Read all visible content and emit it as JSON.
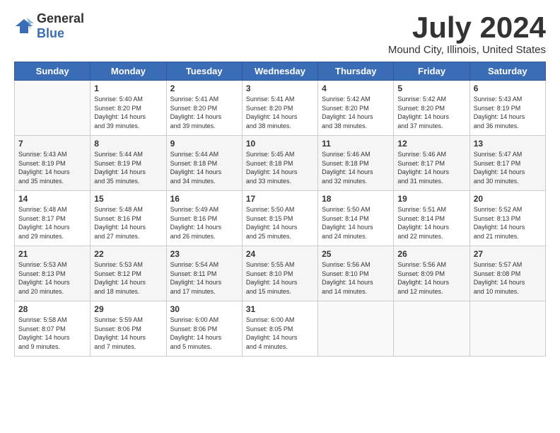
{
  "logo": {
    "general": "General",
    "blue": "Blue"
  },
  "title": "July 2024",
  "location": "Mound City, Illinois, United States",
  "days_of_week": [
    "Sunday",
    "Monday",
    "Tuesday",
    "Wednesday",
    "Thursday",
    "Friday",
    "Saturday"
  ],
  "weeks": [
    [
      {
        "day": "",
        "info": ""
      },
      {
        "day": "1",
        "info": "Sunrise: 5:40 AM\nSunset: 8:20 PM\nDaylight: 14 hours\nand 39 minutes."
      },
      {
        "day": "2",
        "info": "Sunrise: 5:41 AM\nSunset: 8:20 PM\nDaylight: 14 hours\nand 39 minutes."
      },
      {
        "day": "3",
        "info": "Sunrise: 5:41 AM\nSunset: 8:20 PM\nDaylight: 14 hours\nand 38 minutes."
      },
      {
        "day": "4",
        "info": "Sunrise: 5:42 AM\nSunset: 8:20 PM\nDaylight: 14 hours\nand 38 minutes."
      },
      {
        "day": "5",
        "info": "Sunrise: 5:42 AM\nSunset: 8:20 PM\nDaylight: 14 hours\nand 37 minutes."
      },
      {
        "day": "6",
        "info": "Sunrise: 5:43 AM\nSunset: 8:19 PM\nDaylight: 14 hours\nand 36 minutes."
      }
    ],
    [
      {
        "day": "7",
        "info": "Sunrise: 5:43 AM\nSunset: 8:19 PM\nDaylight: 14 hours\nand 35 minutes."
      },
      {
        "day": "8",
        "info": "Sunrise: 5:44 AM\nSunset: 8:19 PM\nDaylight: 14 hours\nand 35 minutes."
      },
      {
        "day": "9",
        "info": "Sunrise: 5:44 AM\nSunset: 8:18 PM\nDaylight: 14 hours\nand 34 minutes."
      },
      {
        "day": "10",
        "info": "Sunrise: 5:45 AM\nSunset: 8:18 PM\nDaylight: 14 hours\nand 33 minutes."
      },
      {
        "day": "11",
        "info": "Sunrise: 5:46 AM\nSunset: 8:18 PM\nDaylight: 14 hours\nand 32 minutes."
      },
      {
        "day": "12",
        "info": "Sunrise: 5:46 AM\nSunset: 8:17 PM\nDaylight: 14 hours\nand 31 minutes."
      },
      {
        "day": "13",
        "info": "Sunrise: 5:47 AM\nSunset: 8:17 PM\nDaylight: 14 hours\nand 30 minutes."
      }
    ],
    [
      {
        "day": "14",
        "info": "Sunrise: 5:48 AM\nSunset: 8:17 PM\nDaylight: 14 hours\nand 29 minutes."
      },
      {
        "day": "15",
        "info": "Sunrise: 5:48 AM\nSunset: 8:16 PM\nDaylight: 14 hours\nand 27 minutes."
      },
      {
        "day": "16",
        "info": "Sunrise: 5:49 AM\nSunset: 8:16 PM\nDaylight: 14 hours\nand 26 minutes."
      },
      {
        "day": "17",
        "info": "Sunrise: 5:50 AM\nSunset: 8:15 PM\nDaylight: 14 hours\nand 25 minutes."
      },
      {
        "day": "18",
        "info": "Sunrise: 5:50 AM\nSunset: 8:14 PM\nDaylight: 14 hours\nand 24 minutes."
      },
      {
        "day": "19",
        "info": "Sunrise: 5:51 AM\nSunset: 8:14 PM\nDaylight: 14 hours\nand 22 minutes."
      },
      {
        "day": "20",
        "info": "Sunrise: 5:52 AM\nSunset: 8:13 PM\nDaylight: 14 hours\nand 21 minutes."
      }
    ],
    [
      {
        "day": "21",
        "info": "Sunrise: 5:53 AM\nSunset: 8:13 PM\nDaylight: 14 hours\nand 20 minutes."
      },
      {
        "day": "22",
        "info": "Sunrise: 5:53 AM\nSunset: 8:12 PM\nDaylight: 14 hours\nand 18 minutes."
      },
      {
        "day": "23",
        "info": "Sunrise: 5:54 AM\nSunset: 8:11 PM\nDaylight: 14 hours\nand 17 minutes."
      },
      {
        "day": "24",
        "info": "Sunrise: 5:55 AM\nSunset: 8:10 PM\nDaylight: 14 hours\nand 15 minutes."
      },
      {
        "day": "25",
        "info": "Sunrise: 5:56 AM\nSunset: 8:10 PM\nDaylight: 14 hours\nand 14 minutes."
      },
      {
        "day": "26",
        "info": "Sunrise: 5:56 AM\nSunset: 8:09 PM\nDaylight: 14 hours\nand 12 minutes."
      },
      {
        "day": "27",
        "info": "Sunrise: 5:57 AM\nSunset: 8:08 PM\nDaylight: 14 hours\nand 10 minutes."
      }
    ],
    [
      {
        "day": "28",
        "info": "Sunrise: 5:58 AM\nSunset: 8:07 PM\nDaylight: 14 hours\nand 9 minutes."
      },
      {
        "day": "29",
        "info": "Sunrise: 5:59 AM\nSunset: 8:06 PM\nDaylight: 14 hours\nand 7 minutes."
      },
      {
        "day": "30",
        "info": "Sunrise: 6:00 AM\nSunset: 8:06 PM\nDaylight: 14 hours\nand 5 minutes."
      },
      {
        "day": "31",
        "info": "Sunrise: 6:00 AM\nSunset: 8:05 PM\nDaylight: 14 hours\nand 4 minutes."
      },
      {
        "day": "",
        "info": ""
      },
      {
        "day": "",
        "info": ""
      },
      {
        "day": "",
        "info": ""
      }
    ]
  ]
}
